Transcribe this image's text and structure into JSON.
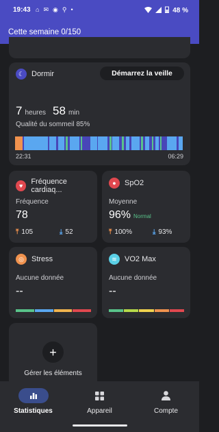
{
  "status": {
    "time": "19:43",
    "battery": "48 %",
    "icons": [
      "home-icon",
      "mail-icon",
      "whatsapp-icon",
      "location-icon",
      "dot-icon"
    ]
  },
  "header": {
    "title": "Cette semaine 0/150"
  },
  "sleep": {
    "title": "Dormir",
    "button": "Démarrez la veille",
    "hours": "7",
    "hours_unit": "heures",
    "minutes": "58",
    "minutes_unit": "min",
    "quality": "Qualité du sommeil 85%",
    "start": "22:31",
    "end": "06:29",
    "stage_colors": {
      "awake": "#f0924e",
      "light": "#5aa7f0",
      "deep": "#4846b8",
      "rem": "#59c38a"
    }
  },
  "heart": {
    "title": "Fréquence cardiaq...",
    "label": "Fréquence",
    "value": "78",
    "max": "105",
    "min": "52"
  },
  "spo2": {
    "title": "SpO2",
    "label": "Moyenne",
    "value": "96%",
    "status": "Normal",
    "max": "100%",
    "min": "93%"
  },
  "stress": {
    "title": "Stress",
    "label": "Aucune donnée",
    "value": "--"
  },
  "vo2": {
    "title": "VO2 Max",
    "label": "Aucune donnée",
    "value": "--"
  },
  "manage": {
    "label": "Gérer les éléments"
  },
  "nav": [
    {
      "label": "Statistiques",
      "icon": "bar-chart-icon"
    },
    {
      "label": "Appareil",
      "icon": "grid-icon"
    },
    {
      "label": "Compte",
      "icon": "person-icon"
    }
  ]
}
